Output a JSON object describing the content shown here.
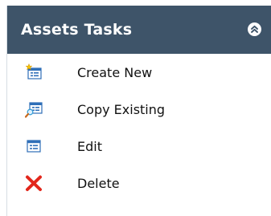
{
  "panel": {
    "title": "Assets Tasks",
    "collapse_icon": "double-chevron-up-icon",
    "items": [
      {
        "label": "Create New",
        "icon": "new-form-icon"
      },
      {
        "label": "Copy Existing",
        "icon": "search-form-icon"
      },
      {
        "label": "Edit",
        "icon": "form-icon"
      },
      {
        "label": "Delete",
        "icon": "red-x-icon"
      }
    ]
  },
  "colors": {
    "header_bg": "#3e5469",
    "header_text": "#ffffff",
    "delete_red": "#e2261b",
    "icon_blue": "#2f6fb8"
  }
}
